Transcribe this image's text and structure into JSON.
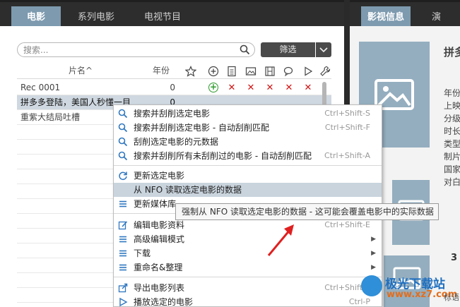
{
  "tabs_left": [
    {
      "label": "电影",
      "active": true
    },
    {
      "label": "系列电影",
      "active": false
    },
    {
      "label": "电视节目",
      "active": false
    }
  ],
  "tabs_right": [
    {
      "label": "影视信息",
      "active": true
    },
    {
      "label": "演",
      "active": false
    }
  ],
  "search": {
    "placeholder": "搜索..."
  },
  "filter": {
    "label": "筛选"
  },
  "table": {
    "col_name": "片名^",
    "col_year": "年份",
    "rows": [
      {
        "name": "Rec 0001",
        "year": "0"
      },
      {
        "name": "拼多多登陆，美国人秒懂一目",
        "year": "0"
      },
      {
        "name": "重紫大结局吐槽",
        "year": ""
      }
    ]
  },
  "details": {
    "title": "拼多",
    "fields": [
      "年份",
      "上映",
      "分级",
      "时长",
      "类型",
      "制片",
      "国家",
      "对白"
    ],
    "rating": "3"
  },
  "menu": {
    "items": [
      {
        "label": "搜索并刮削选定电影",
        "shortcut": "Ctrl+Shift-S",
        "icon": "search-icon"
      },
      {
        "label": "搜索并刮削选定电影 - 自动刮削匹配",
        "shortcut": "Ctrl+Shift-F",
        "icon": "search-icon"
      },
      {
        "label": "刮削选定电影的元数据",
        "shortcut": "",
        "icon": "search-icon"
      },
      {
        "label": "搜索并刮削所有未刮削过的电影 - 自动刮削匹配",
        "shortcut": "Ctrl+Shift-A",
        "icon": "search-icon"
      },
      {
        "label": "更新选定电影",
        "shortcut": "",
        "icon": "refresh-icon"
      },
      {
        "label": "从 NFO 读取选定电影的数据",
        "shortcut": "",
        "icon": ""
      },
      {
        "label": "更新媒体库",
        "shortcut": "",
        "icon": "list-icon"
      },
      {
        "label": "编辑电影资料",
        "shortcut": "Ctrl+Shift-E",
        "icon": "edit-icon"
      },
      {
        "label": "高级编辑模式",
        "shortcut": "",
        "icon": "list-icon"
      },
      {
        "label": "下载",
        "shortcut": "",
        "icon": "list-icon"
      },
      {
        "label": "重命名&整理",
        "shortcut": "",
        "icon": "list-icon"
      },
      {
        "label": "导出电影列表",
        "shortcut": "Ctrl+Shift-X",
        "icon": "export-icon"
      },
      {
        "label": "播放选定的电影",
        "shortcut": "Ctrl-P",
        "icon": "play-icon"
      }
    ]
  },
  "tooltip": "强制从 NFO 读取选定电影的数据 - 这可能会覆盖电影中的实际数据",
  "watermark": {
    "line1": "极光下载站",
    "line2": "www.xz7.com",
    "tail": "标语"
  },
  "colors": {
    "accent": "#7d9aaf",
    "poster": "#94aebf",
    "menu_highlight": "#c9d4dd",
    "mark_red": "#d01414",
    "mark_green": "#2e9a2e",
    "arrow_red": "#e02020"
  }
}
